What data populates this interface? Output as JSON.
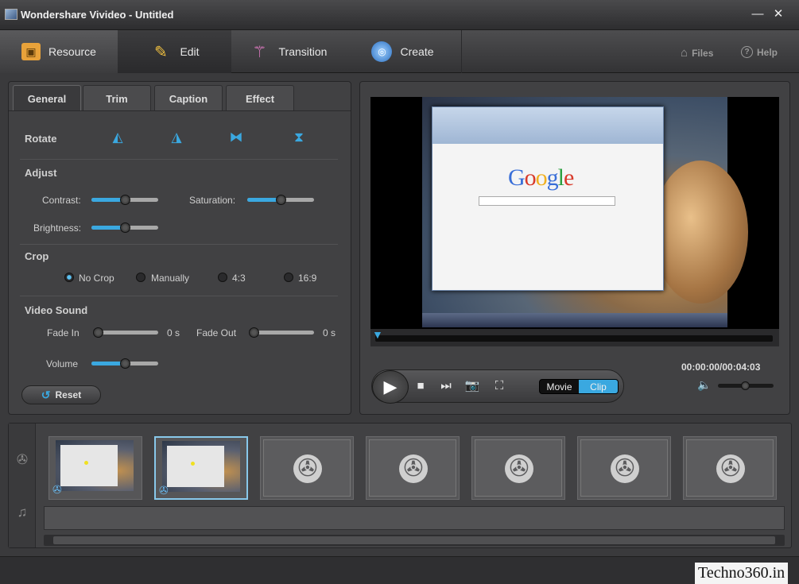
{
  "window": {
    "title": "Wondershare Vivideo - Untitled",
    "minimize": "—",
    "close": "✕"
  },
  "nav": {
    "tabs": [
      {
        "label": "Resource",
        "icon": "folder-icon"
      },
      {
        "label": "Edit",
        "icon": "pencil-icon"
      },
      {
        "label": "Transition",
        "icon": "magic-wand-icon"
      },
      {
        "label": "Create",
        "icon": "globe-icon"
      }
    ],
    "files": "Files",
    "help": "Help"
  },
  "edit": {
    "subtabs": [
      "General",
      "Trim",
      "Caption",
      "Effect"
    ],
    "rotate": {
      "label": "Rotate"
    },
    "adjust": {
      "label": "Adjust",
      "contrast": "Contrast:",
      "saturation": "Saturation:",
      "brightness": "Brightness:",
      "contrast_value": 0.5,
      "saturation_value": 0.5,
      "brightness_value": 0.5
    },
    "crop": {
      "label": "Crop",
      "options": [
        "No Crop",
        "Manually",
        "4:3",
        "16:9"
      ],
      "selected": "No Crop"
    },
    "sound": {
      "label": "Video Sound",
      "fade_in": "Fade In",
      "fade_in_value": "0 s",
      "fade_out": "Fade Out",
      "fade_out_value": "0 s",
      "volume": "Volume",
      "volume_value": 0.5
    },
    "reset": "Reset"
  },
  "player": {
    "timecode": "00:00:00/00:04:03",
    "modes": [
      "Movie",
      "Clip"
    ],
    "selected_mode": "Clip",
    "preview_logo": "Google",
    "volume_level": 0.5
  },
  "watermark": "Techno360.in",
  "colors": {
    "accent": "#3aa8e0",
    "panel": "#414143"
  }
}
